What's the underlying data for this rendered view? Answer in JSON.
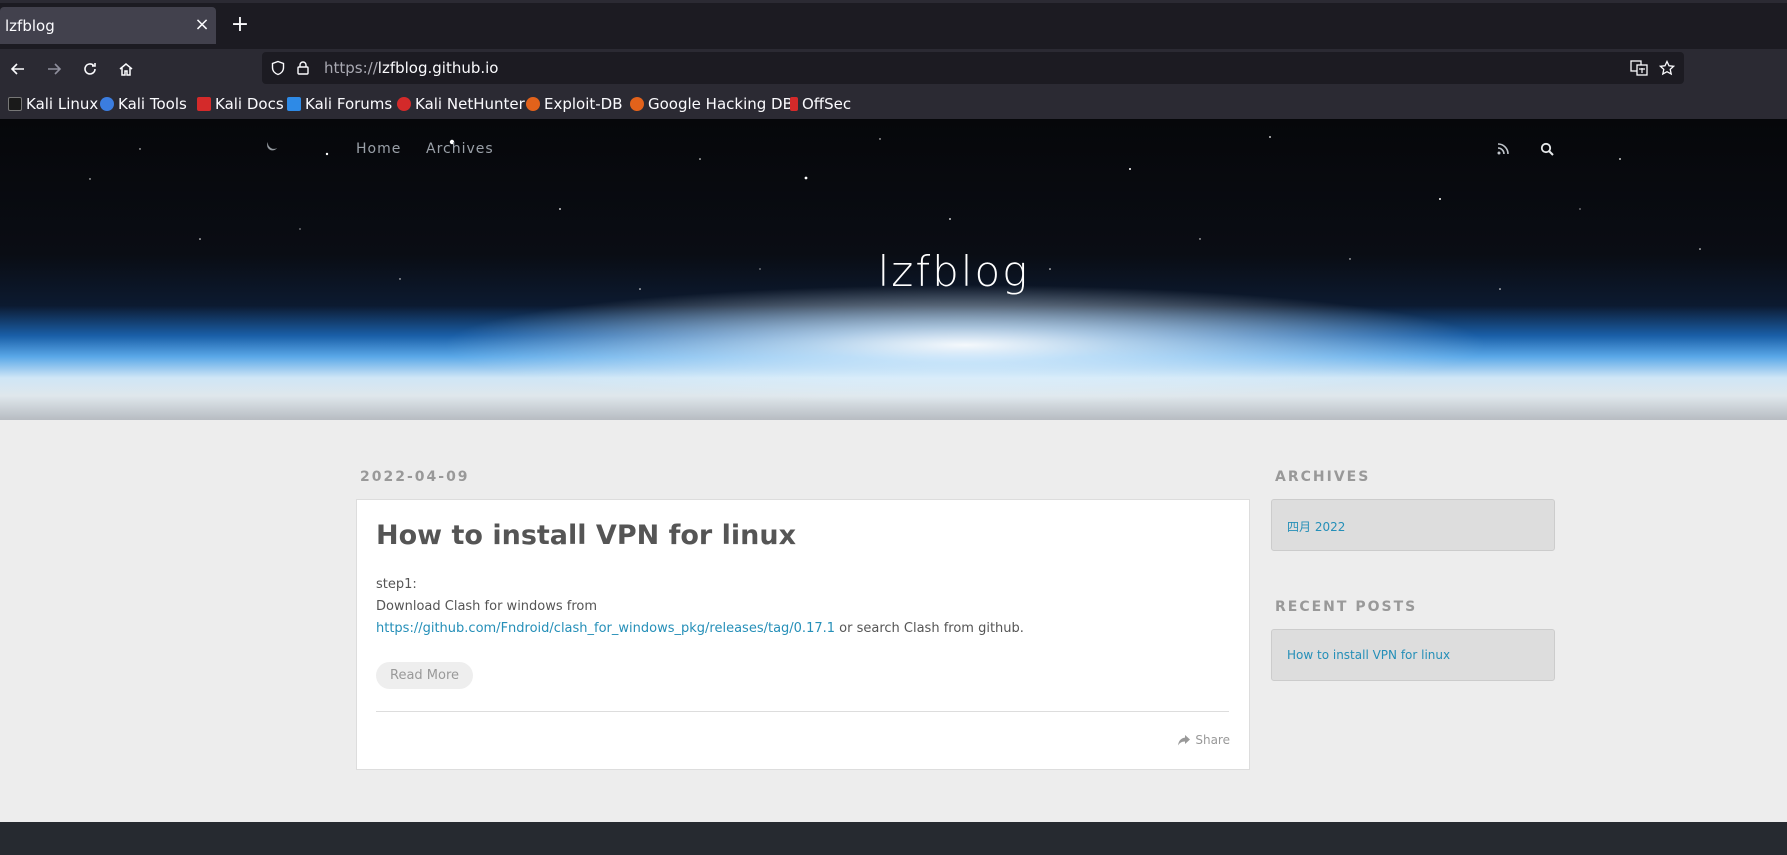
{
  "browser": {
    "tab_title": "lzfblog",
    "tab_close": "×",
    "new_tab": "+",
    "url_scheme": "https://",
    "url_host": "lzfblog.github.io"
  },
  "bookmarks": [
    {
      "label": "Kali Linux",
      "color": "#1a1a1a"
    },
    {
      "label": "Kali Tools",
      "color": "#3b7de0"
    },
    {
      "label": "Kali Docs",
      "color": "#d42a2a"
    },
    {
      "label": "Kali Forums",
      "color": "#2e8ae6"
    },
    {
      "label": "Kali NetHunter",
      "color": "#d42a2a"
    },
    {
      "label": "Exploit-DB",
      "color": "#e2621b"
    },
    {
      "label": "Google Hacking DB",
      "color": "#e2621b"
    },
    {
      "label": "OffSec",
      "color": "#d42a2a"
    }
  ],
  "site": {
    "title": "lzfblog",
    "nav": [
      "Home",
      "Archives"
    ]
  },
  "post": {
    "date": "2022-04-09",
    "title": "How to install VPN for linux",
    "line1": "step1:",
    "line2": "Download Clash for windows from",
    "link": "https://github.com/Fndroid/clash_for_windows_pkg/releases/tag/0.17.1",
    "line3_suffix": " or search Clash from github.",
    "read_more": "Read More",
    "share": "Share"
  },
  "sidebar": {
    "archives_title": "ARCHIVES",
    "archives_item": "四月 2022",
    "recent_title": "RECENT POSTS",
    "recent_item": "How to install VPN for linux"
  },
  "colors": {
    "link": "#258fb8",
    "chrome_dark": "#1c1b22",
    "chrome": "#2b2a33"
  }
}
